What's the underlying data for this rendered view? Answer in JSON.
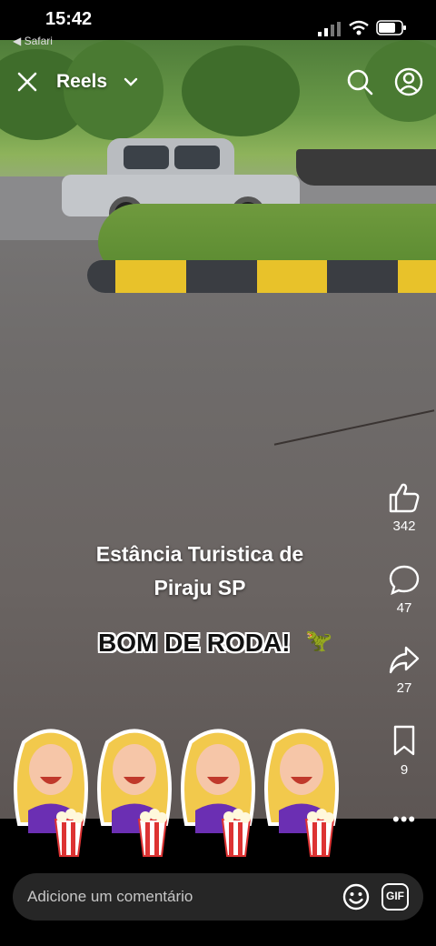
{
  "status_bar": {
    "time": "15:42",
    "back_app": "◀ Safari"
  },
  "header": {
    "title": "Reels"
  },
  "video": {
    "caption_line1": "Estância Turistica de",
    "caption_line2": "Piraju SP",
    "overlay_text": "BOM DE RODA!",
    "overlay_emoji": "🦖"
  },
  "actions": {
    "likes": "342",
    "comments": "47",
    "shares": "27",
    "saves": "9",
    "more": "•••"
  },
  "comment_bar": {
    "placeholder": "Adicione um comentário",
    "gif_label": "GIF"
  },
  "colors": {
    "accent_yellow": "#e8c22a",
    "curb_dark": "#3a3d42",
    "comment_bg": "#262626"
  }
}
